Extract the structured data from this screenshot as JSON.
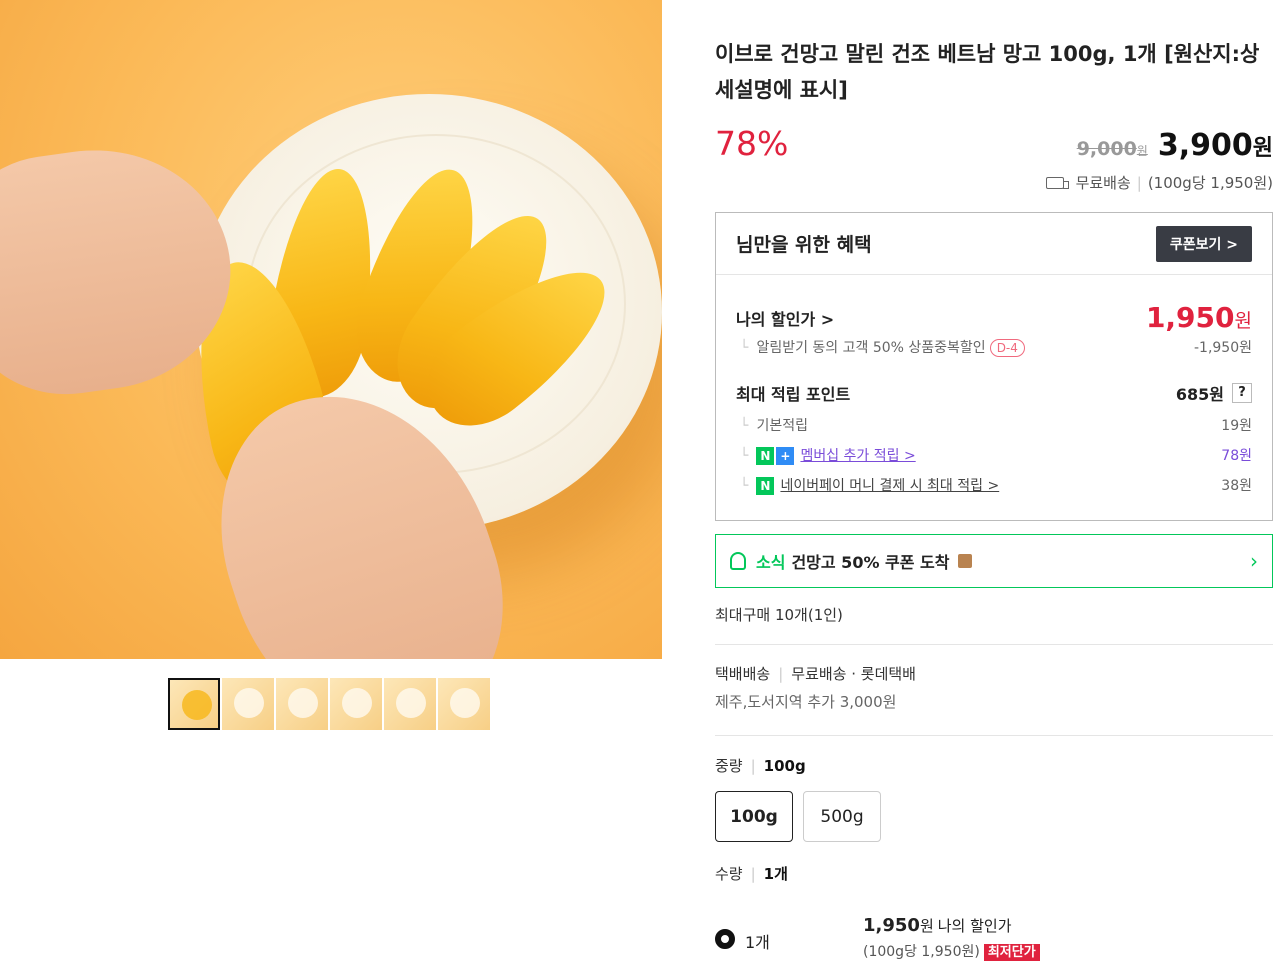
{
  "product": {
    "title": "이브로 건망고 말린 건조 베트남 망고 100g, 1개 [원산지:상세설명에 표시]",
    "discount": "78%",
    "original_price": "9,000",
    "won": "원",
    "sale_price": "3,900",
    "shipping": "무료배송",
    "unit_price": "(100g당 1,950원)"
  },
  "gallery": {
    "thumb_count": 6
  },
  "benefit": {
    "title": "님만을 위한 혜택",
    "coupon_button": "쿠폰보기 >",
    "my_price_label": "나의 할인가 >",
    "my_price": "1,950",
    "alarm_discount": "알림받기 동의 고객 50% 상품중복할인",
    "d_badge": "D-4",
    "alarm_amount": "-1,950원",
    "point_label": "최대 적립 포인트",
    "point_total": "685원",
    "help": "?",
    "basic_label": "기본적립",
    "basic_value": "19원",
    "membership_label": "멤버십 추가 적립 >",
    "membership_value": "78원",
    "npay_label": "네이버페이 머니 결제 시 최대 적립 >",
    "npay_value": "38원"
  },
  "news": {
    "tag": "소식",
    "text": "건망고 50% 쿠폰 도착"
  },
  "max_buy": "최대구매 10개(1인)",
  "delivery": {
    "type": "택배배송",
    "detail": "무료배송 · 롯데택배",
    "extra": "제주,도서지역 추가 3,000원"
  },
  "options": {
    "weight_label": "중량",
    "weight_selected": "100g",
    "weights": [
      "100g",
      "500g"
    ],
    "qty_label": "수량",
    "qty_selected": "1개"
  },
  "qty_option": {
    "name": "1개",
    "price": "1,950",
    "price_label": "나의 할인가",
    "unit": "(100g당 1,950원)",
    "lowest": "최저단가"
  },
  "colors": {
    "accent_red": "#e0223e",
    "naver_green": "#03c75a",
    "link_purple": "#7a4cd9"
  }
}
